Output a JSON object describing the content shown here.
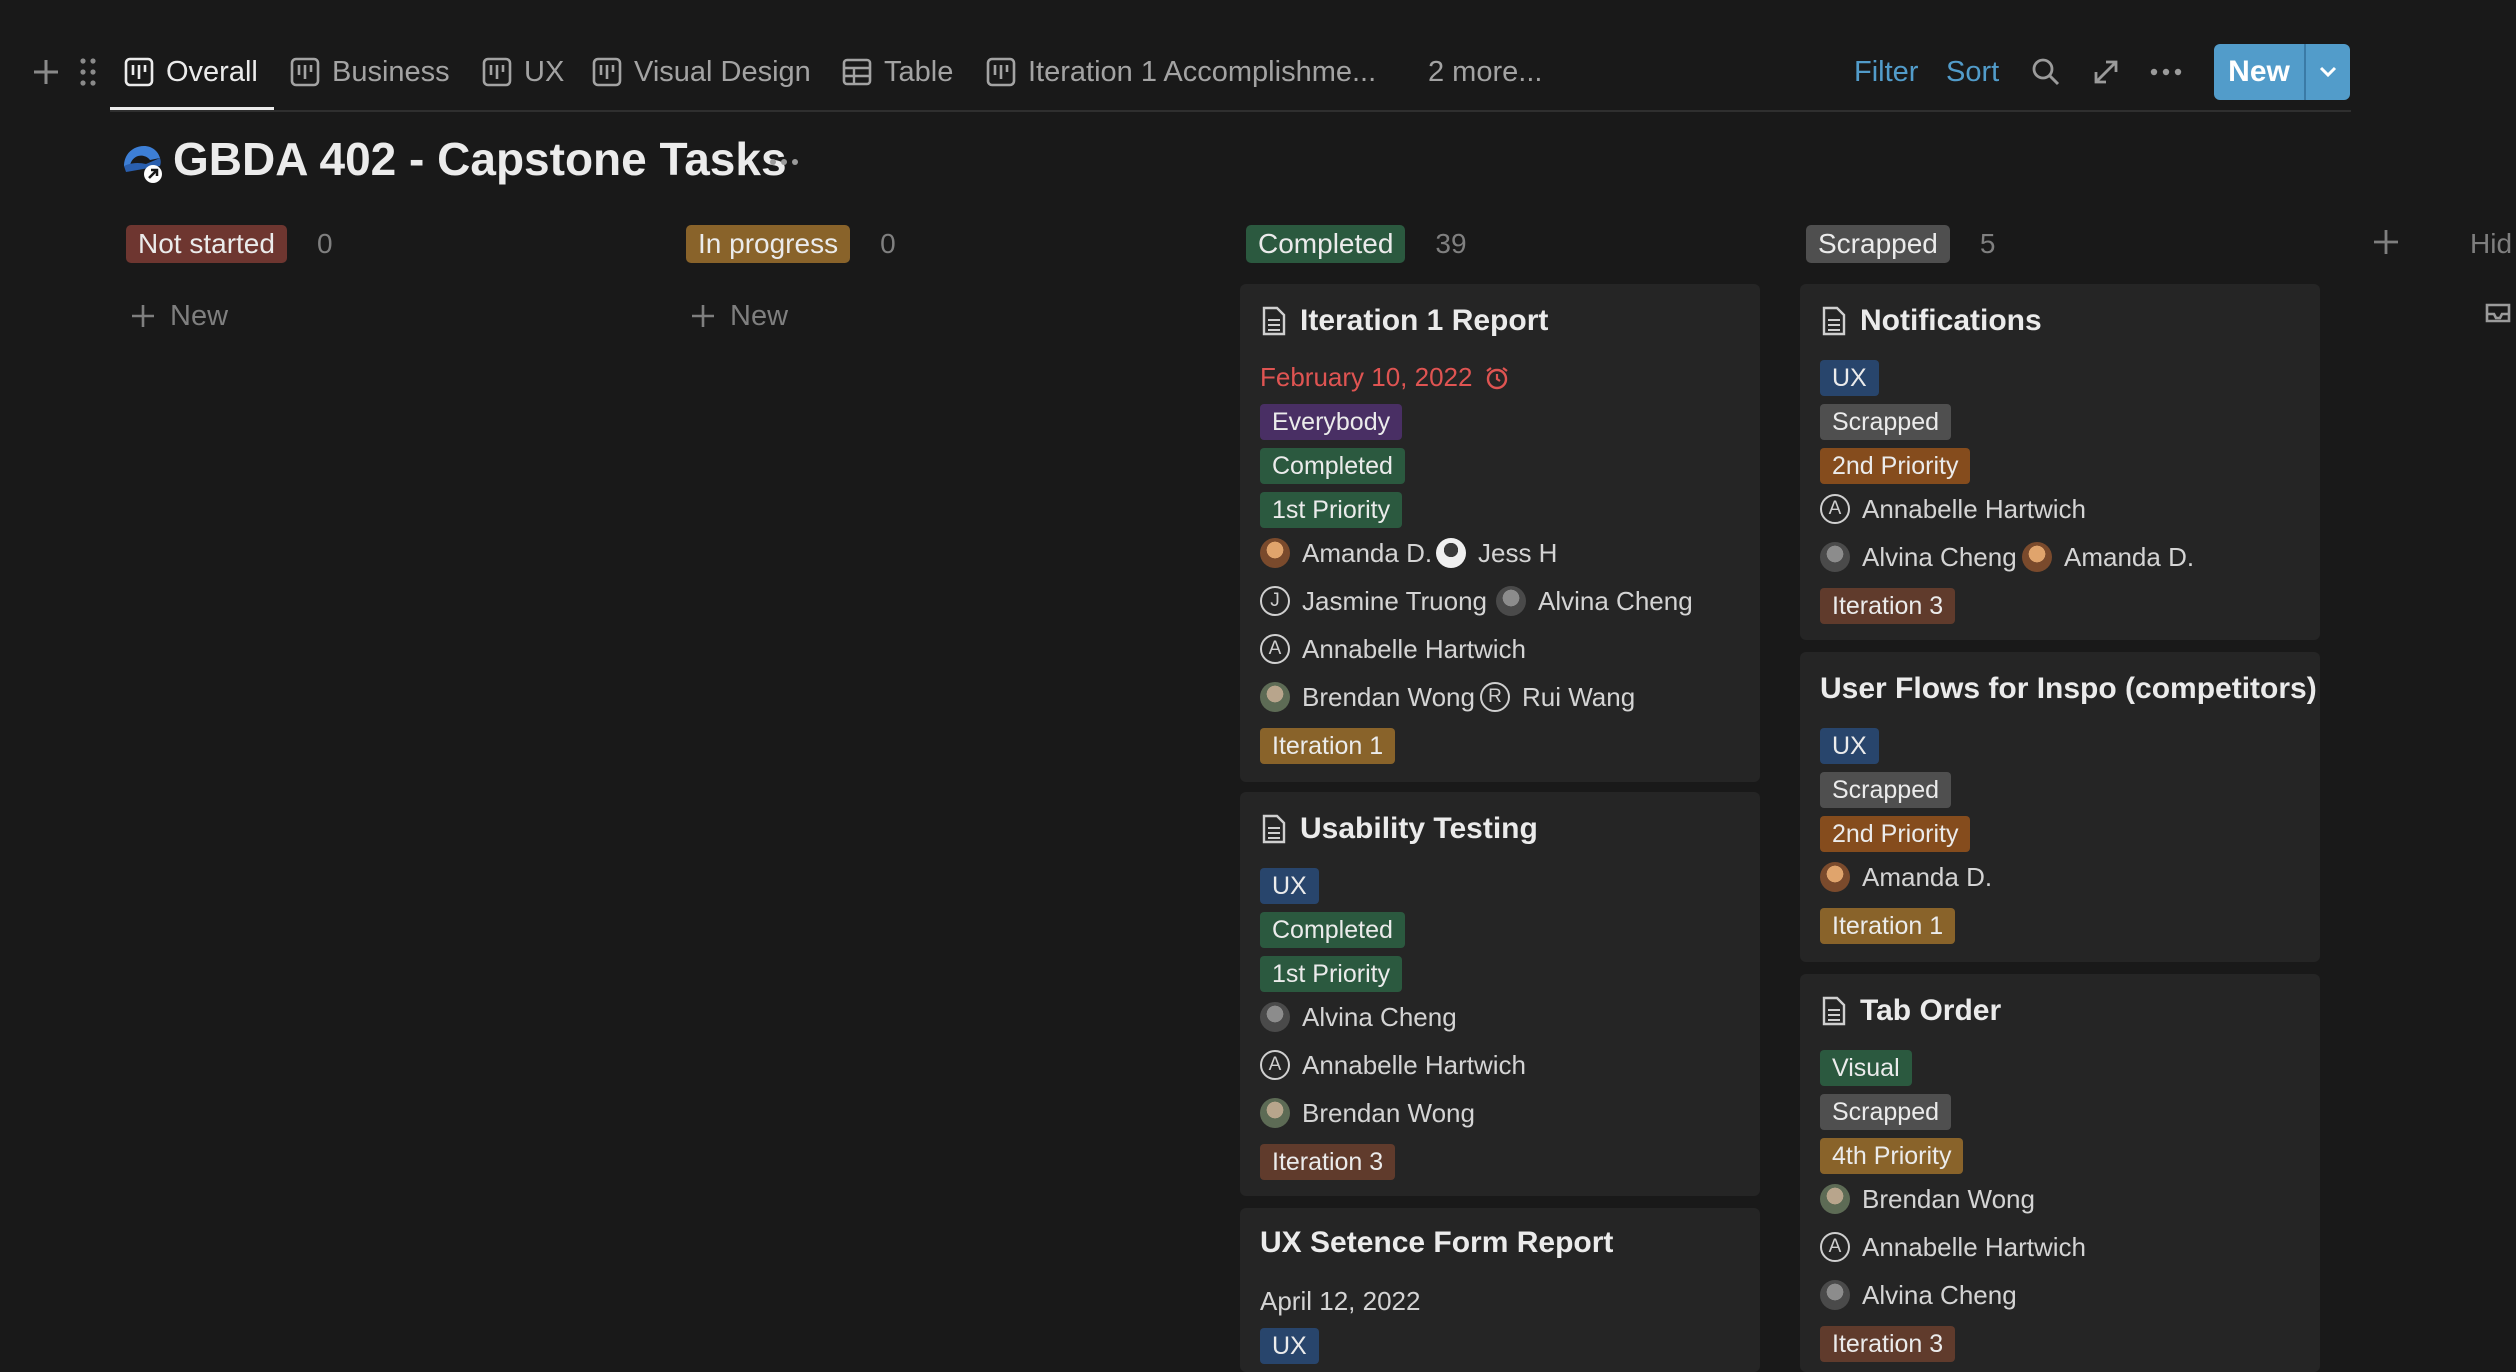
{
  "tabs": [
    {
      "label": "Overall",
      "active": true
    },
    {
      "label": "Business"
    },
    {
      "label": "UX"
    },
    {
      "label": "Visual Design"
    },
    {
      "label": "Table"
    },
    {
      "label": "Iteration 1 Accomplishme..."
    }
  ],
  "more_views": "2 more...",
  "toolbar": {
    "filter": "Filter",
    "sort": "Sort",
    "new": "New"
  },
  "page": {
    "title": "GBDA 402 - Capstone Tasks"
  },
  "columns": [
    {
      "status": "Not started",
      "count": "0",
      "add_label": "New"
    },
    {
      "status": "In progress",
      "count": "0",
      "add_label": "New"
    },
    {
      "status": "Completed",
      "count": "39"
    },
    {
      "status": "Scrapped",
      "count": "5"
    }
  ],
  "hidden_label": "Hid",
  "cards": {
    "iteration1": {
      "title": "Iteration 1 Report",
      "date": "February 10, 2022",
      "tags": [
        "Everybody",
        "Completed",
        "1st Priority"
      ],
      "people": [
        "Amanda D.",
        "Jess H",
        "Jasmine Truong",
        "Alvina Cheng",
        "Annabelle Hartwich",
        "Brendan Wong",
        "Rui Wang"
      ],
      "iteration": "Iteration 1"
    },
    "usability": {
      "title": "Usability Testing",
      "tags": [
        "UX",
        "Completed",
        "1st Priority"
      ],
      "people": [
        "Alvina Cheng",
        "Annabelle Hartwich",
        "Brendan Wong"
      ],
      "iteration": "Iteration 3"
    },
    "uxsentence": {
      "title": "UX Setence Form Report",
      "date": "April 12, 2022",
      "tags": [
        "UX"
      ]
    },
    "notifications": {
      "title": "Notifications",
      "tags": [
        "UX",
        "Scrapped",
        "2nd Priority"
      ],
      "people": [
        "Annabelle Hartwich",
        "Alvina Cheng",
        "Amanda D."
      ],
      "iteration": "Iteration 3"
    },
    "userflows": {
      "title": "User Flows for Inspo (competitors)",
      "tags": [
        "UX",
        "Scrapped",
        "2nd Priority"
      ],
      "people": [
        "Amanda D."
      ],
      "iteration": "Iteration 1"
    },
    "taborder": {
      "title": "Tab Order",
      "tags": [
        "Visual",
        "Scrapped",
        "4th Priority"
      ],
      "people": [
        "Brendan Wong",
        "Annabelle Hartwich",
        "Alvina Cheng"
      ],
      "iteration": "Iteration 3"
    }
  },
  "colors": {
    "accent": "#529cca",
    "overdue": "#df5452",
    "background": "#191919",
    "card": "#252525"
  }
}
